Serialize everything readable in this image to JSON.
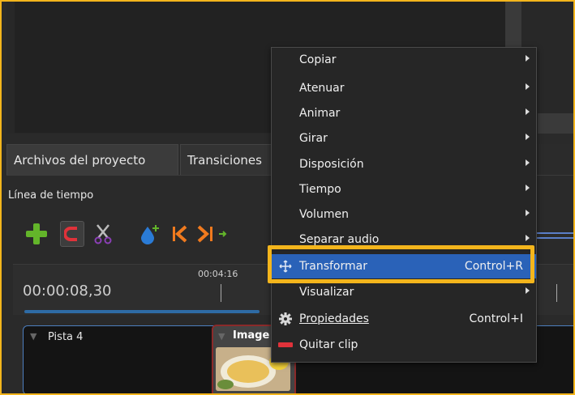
{
  "tabs": [
    {
      "label": "Archivos del proyecto",
      "active": true
    },
    {
      "label": "Transiciones",
      "active": false
    }
  ],
  "timeline": {
    "label": "Línea de tiempo",
    "timecode": "00:00:08,30",
    "ruler_tick": "00:04:16"
  },
  "toolbar": {
    "icons": [
      "plus-icon",
      "magnet-icon",
      "scissors-icon",
      "marker-icon",
      "jump-start-icon",
      "jump-end-icon"
    ]
  },
  "track": {
    "name": "Pista 4",
    "clip_title": "Image"
  },
  "context_menu": {
    "items": [
      {
        "label": "Copiar",
        "submenu": true
      },
      {
        "label": "Atenuar",
        "submenu": true
      },
      {
        "label": "Animar",
        "submenu": true
      },
      {
        "label": "Girar",
        "submenu": true
      },
      {
        "label": "Disposición",
        "submenu": true
      },
      {
        "label": "Tiempo",
        "submenu": true
      },
      {
        "label": "Volumen",
        "submenu": true
      },
      {
        "label": "Separar audio",
        "submenu": true
      },
      {
        "label": "Transformar",
        "shortcut": "Control+R",
        "icon": "move-icon",
        "highlighted": true
      },
      {
        "label": "Visualizar",
        "submenu": true
      },
      {
        "label": "Propiedades",
        "shortcut": "Control+I",
        "icon": "gear-icon"
      },
      {
        "label": "Quitar clip",
        "icon": "remove-icon"
      }
    ]
  },
  "colors": {
    "accent_highlight": "#f3b51c",
    "menu_selection": "#2a62b8",
    "track_border": "#4d7fbf",
    "clip_border": "#8b2a2a"
  }
}
